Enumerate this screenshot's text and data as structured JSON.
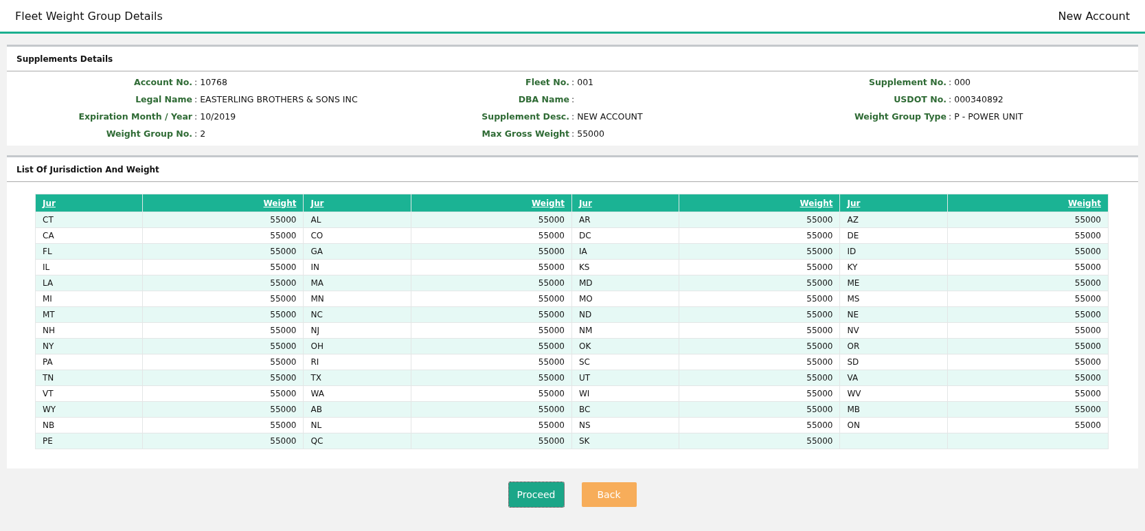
{
  "header": {
    "title": "Fleet Weight Group Details",
    "account_type": "New Account"
  },
  "supplements": {
    "title": "Supplements Details",
    "columns": [
      [
        {
          "label": "Account No.",
          "separator": ":",
          "value": "10768"
        },
        {
          "label": "Legal Name",
          "separator": ":",
          "value": "EASTERLING BROTHERS & SONS INC"
        },
        {
          "label": "Expiration Month / Year",
          "separator": ":",
          "value": "10/2019"
        },
        {
          "label": "Weight Group No.",
          "separator": ":",
          "value": "2"
        }
      ],
      [
        {
          "label": "Fleet No.",
          "separator": ":",
          "value": "001"
        },
        {
          "label": "DBA Name",
          "separator": ":"
        },
        {
          "label": "Supplement Desc.",
          "separator": ":",
          "value": "NEW ACCOUNT"
        },
        {
          "label": "Max Gross Weight",
          "separator": ":",
          "value": "55000"
        }
      ],
      [
        {
          "label": "Supplement No.",
          "separator": ":",
          "value": "000"
        },
        {
          "label": "USDOT No.",
          "separator": ":",
          "value": "000340892"
        },
        {
          "label": "Weight Group Type",
          "separator": ":",
          "value": "P - POWER UNIT"
        }
      ]
    ]
  },
  "jurisdictions": {
    "title": "List Of Jurisdiction And Weight",
    "columns": [
      "Jur",
      "Weight",
      "Jur",
      "Weight",
      "Jur",
      "Weight",
      "Jur",
      "Weight"
    ],
    "rows": [
      [
        "CT",
        "55000",
        "AL",
        "55000",
        "AR",
        "55000",
        "AZ",
        "55000"
      ],
      [
        "CA",
        "55000",
        "CO",
        "55000",
        "DC",
        "55000",
        "DE",
        "55000"
      ],
      [
        "FL",
        "55000",
        "GA",
        "55000",
        "IA",
        "55000",
        "ID",
        "55000"
      ],
      [
        "IL",
        "55000",
        "IN",
        "55000",
        "KS",
        "55000",
        "KY",
        "55000"
      ],
      [
        "LA",
        "55000",
        "MA",
        "55000",
        "MD",
        "55000",
        "ME",
        "55000"
      ],
      [
        "MI",
        "55000",
        "MN",
        "55000",
        "MO",
        "55000",
        "MS",
        "55000"
      ],
      [
        "MT",
        "55000",
        "NC",
        "55000",
        "ND",
        "55000",
        "NE",
        "55000"
      ],
      [
        "NH",
        "55000",
        "NJ",
        "55000",
        "NM",
        "55000",
        "NV",
        "55000"
      ],
      [
        "NY",
        "55000",
        "OH",
        "55000",
        "OK",
        "55000",
        "OR",
        "55000"
      ],
      [
        "PA",
        "55000",
        "RI",
        "55000",
        "SC",
        "55000",
        "SD",
        "55000"
      ],
      [
        "TN",
        "55000",
        "TX",
        "55000",
        "UT",
        "55000",
        "VA",
        "55000"
      ],
      [
        "VT",
        "55000",
        "WA",
        "55000",
        "WI",
        "55000",
        "WV",
        "55000"
      ],
      [
        "WY",
        "55000",
        "AB",
        "55000",
        "BC",
        "55000",
        "MB",
        "55000"
      ],
      [
        "NB",
        "55000",
        "NL",
        "55000",
        "NS",
        "55000",
        "ON",
        "55000"
      ],
      [
        "PE",
        "55000",
        "QC",
        "55000",
        "SK",
        "55000"
      ]
    ]
  },
  "buttons": [
    {
      "label": "Proceed",
      "kind": "primary",
      "focused": true
    },
    {
      "label": "Back",
      "kind": "secondary",
      "focused": false
    }
  ]
}
